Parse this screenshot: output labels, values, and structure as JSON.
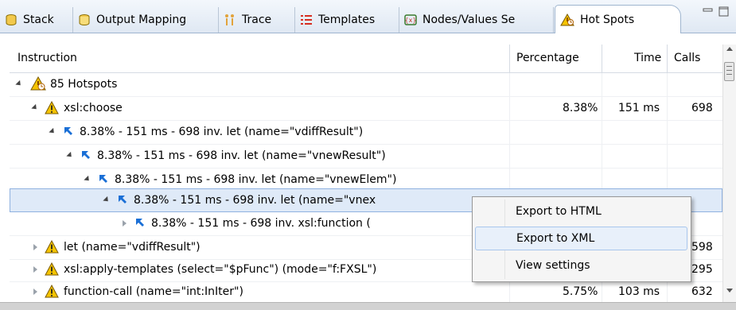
{
  "tabs": [
    {
      "label": "Stack",
      "icon": "stack-icon"
    },
    {
      "label": "Output Mapping",
      "icon": "output-mapping-icon"
    },
    {
      "label": "Trace",
      "icon": "trace-icon"
    },
    {
      "label": "Templates",
      "icon": "templates-icon"
    },
    {
      "label": "Nodes/Values Se",
      "icon": "nodes-values-icon"
    },
    {
      "label": "Hot Spots",
      "icon": "hot-spots-icon",
      "active": true
    }
  ],
  "table": {
    "columns": {
      "instruction": "Instruction",
      "percentage": "Percentage",
      "time": "Time",
      "calls": "Calls"
    },
    "rows": [
      {
        "label": "85 Hotspots",
        "percentage": "",
        "time": "",
        "calls": ""
      },
      {
        "label": "xsl:choose",
        "percentage": "8.38%",
        "time": "151 ms",
        "calls": "698"
      },
      {
        "label": "8.38% - 151 ms - 698 inv. let (name=\"vdiffResult\")",
        "percentage": "",
        "time": "",
        "calls": ""
      },
      {
        "label": "8.38% - 151 ms - 698 inv. let (name=\"vnewResult\")",
        "percentage": "",
        "time": "",
        "calls": ""
      },
      {
        "label": "8.38% - 151 ms - 698 inv. let (name=\"vnewElem\")",
        "percentage": "",
        "time": "",
        "calls": ""
      },
      {
        "label": "8.38% - 151 ms - 698 inv. let (name=\"vnex",
        "percentage": "",
        "time": "",
        "calls": ""
      },
      {
        "label": "8.38% - 151 ms - 698 inv. xsl:function (",
        "percentage": "",
        "time": "",
        "calls": ""
      },
      {
        "label": "let (name=\"vdiffResult\")",
        "percentage": "",
        "time": "",
        "calls": "598"
      },
      {
        "label": "xsl:apply-templates (select=\"$pFunc\") (mode=\"f:FXSL\")",
        "percentage": "",
        "time": "",
        "calls": "295"
      },
      {
        "label": "function-call (name=\"int:InIter\")",
        "percentage": "5.75%",
        "time": "103 ms",
        "calls": "632"
      }
    ]
  },
  "context_menu": {
    "items": [
      "Export to HTML",
      "Export to XML",
      "View settings"
    ],
    "hovered": "Export to XML"
  },
  "colors": {
    "selection": "#dfeaf8",
    "accent": "#1a6fd6",
    "warning": "#f5c400"
  }
}
